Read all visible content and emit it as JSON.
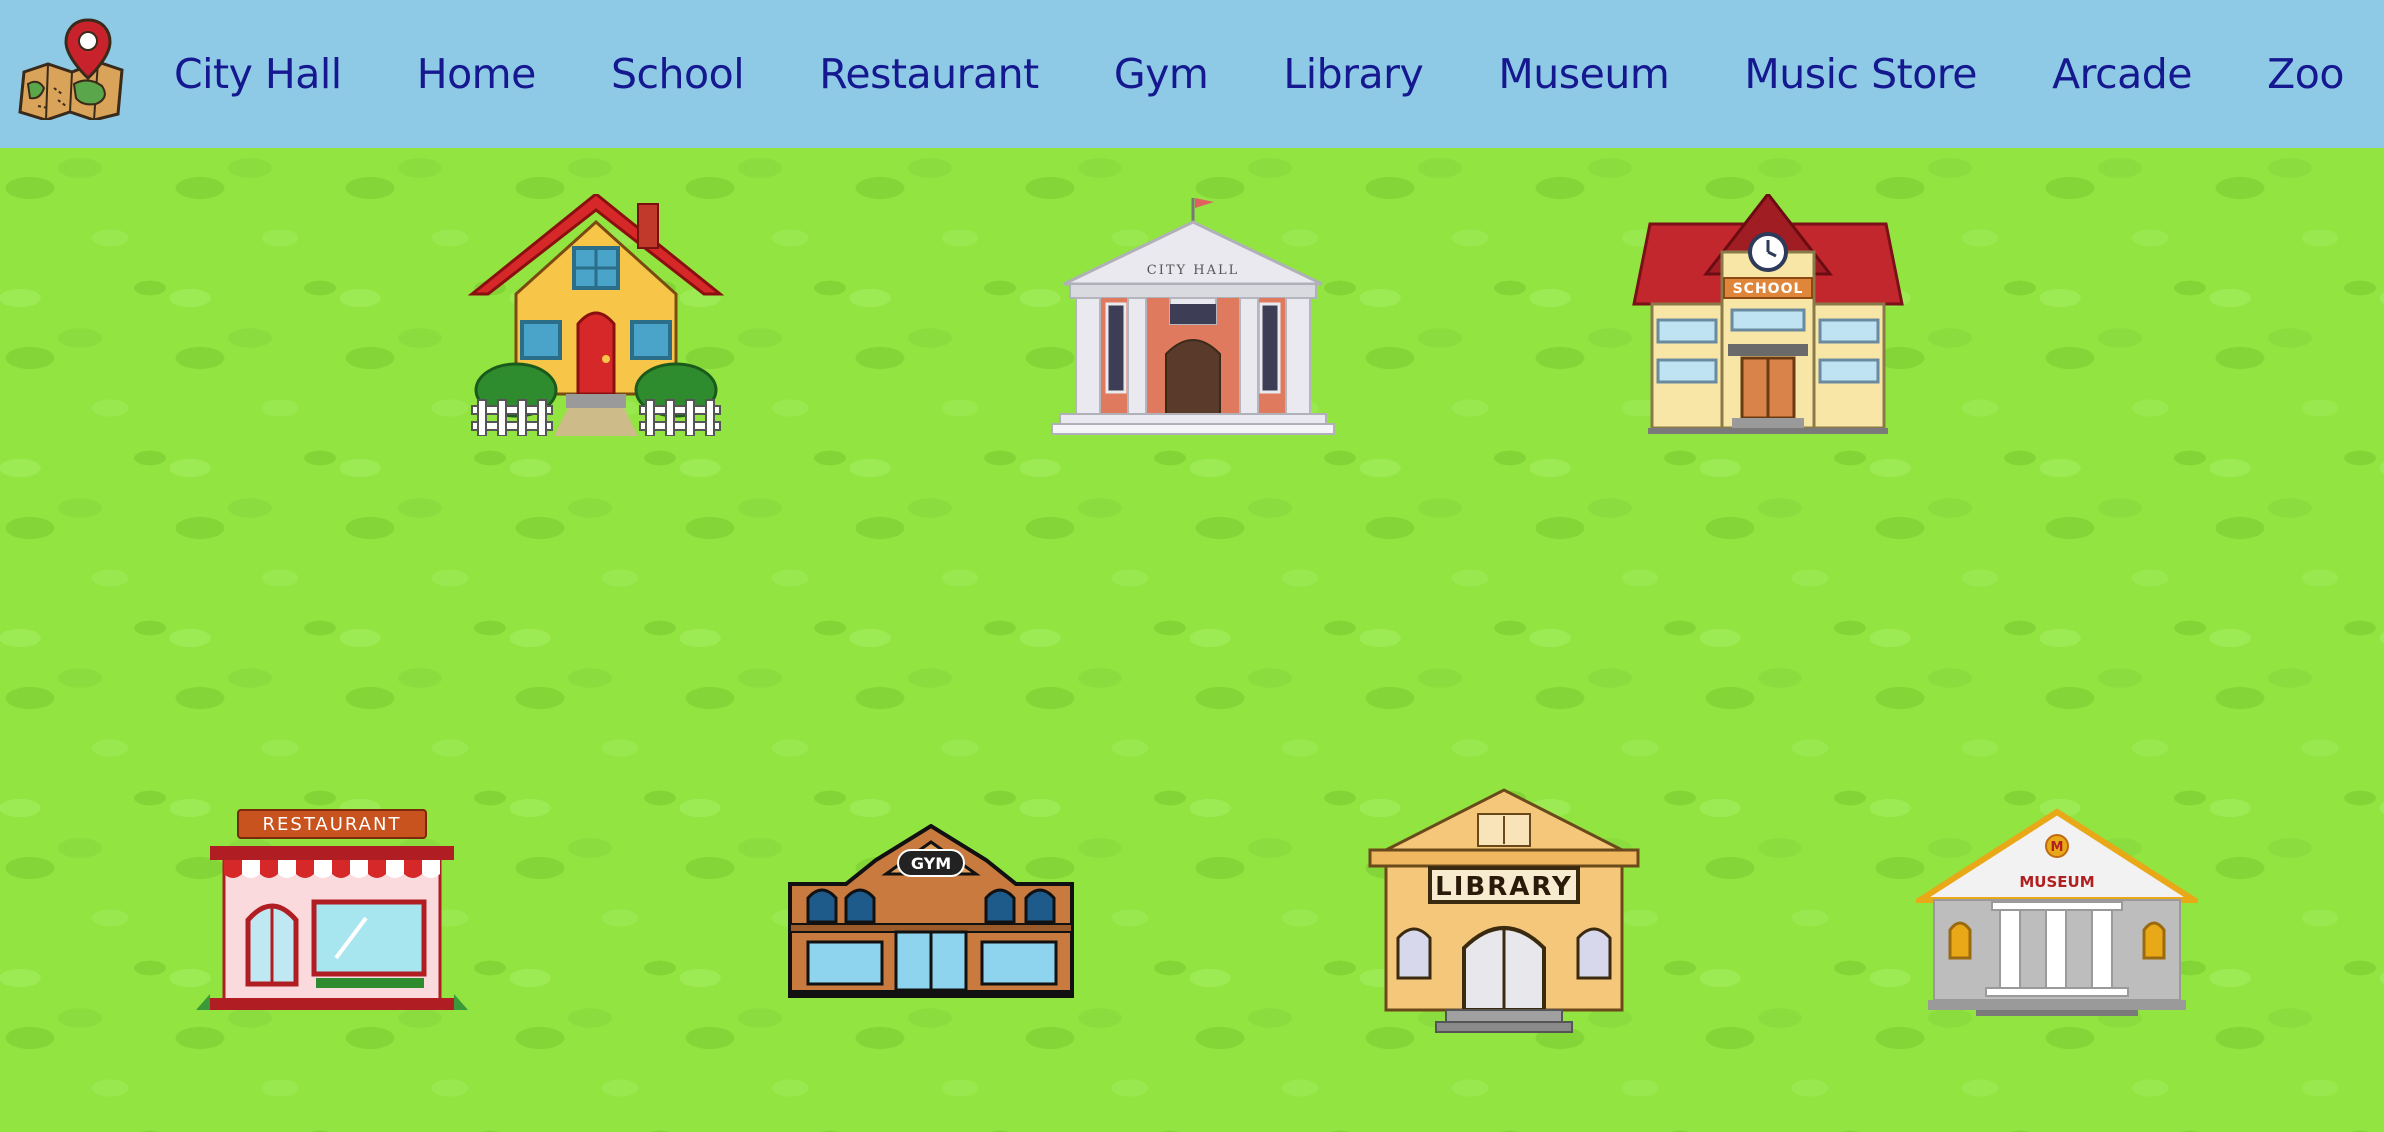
{
  "nav": {
    "links": [
      "City Hall",
      "Home",
      "School",
      "Restaurant",
      "Gym",
      "Library",
      "Museum",
      "Music Store",
      "Arcade",
      "Zoo"
    ]
  },
  "buildings": {
    "city_hall_sign": "CITY HALL",
    "school_sign": "SCHOOL",
    "restaurant_sign": "RESTAURANT",
    "gym_sign": "GYM",
    "library_sign": "LIBRARY",
    "museum_sign": "MUSEUM",
    "museum_badge": "M"
  },
  "colors": {
    "nav_bg": "#8ecae6",
    "nav_text": "#15188f",
    "grass": "#92e441"
  },
  "icons": {
    "logo": "map-pin-icon"
  }
}
